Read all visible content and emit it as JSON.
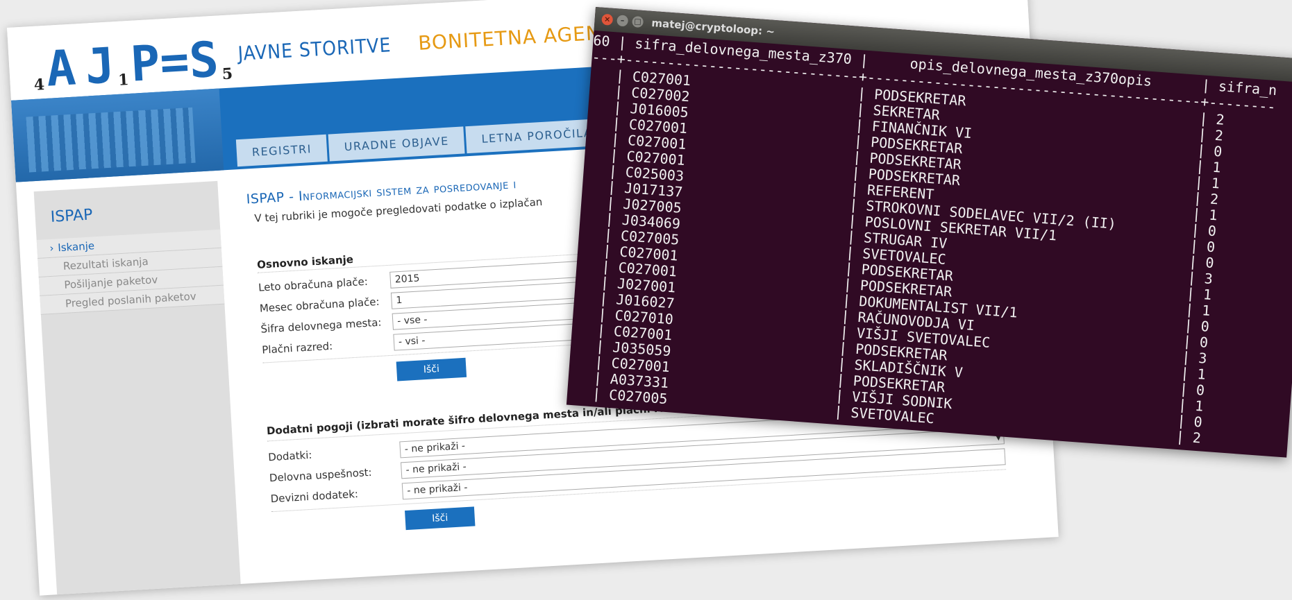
{
  "site": {
    "logo": {
      "letters": [
        "A",
        "J",
        "P",
        "=",
        "S"
      ],
      "subscripts": [
        "4",
        "1",
        "5"
      ]
    },
    "header_links": [
      "JAVNE STORITVE",
      "BONITETNA AGENCIJ"
    ],
    "nav_tabs": [
      "REGISTRI",
      "URADNE OBJAVE",
      "LETNA POROČILA"
    ],
    "sidebar": {
      "title": "ISPAP",
      "items": [
        {
          "label": "Iskanje",
          "active": true
        },
        {
          "label": "Rezultati iskanja",
          "active": false
        },
        {
          "label": "Pošiljanje paketov",
          "active": false
        },
        {
          "label": "Pregled poslanih paketov",
          "active": false
        }
      ]
    },
    "main": {
      "title": "ISPAP - Informacijski sistem za posredovanje i",
      "description": "V tej rubriki je mogoče pregledovati podatke o izplačan",
      "basic": {
        "title": "Osnovno iskanje",
        "fields": [
          {
            "label": "Leto obračuna plače:",
            "value": "2015"
          },
          {
            "label": "Mesec obračuna plače:",
            "value": "1"
          },
          {
            "label": "Šifra delovnega mesta:",
            "value": "- vse -"
          },
          {
            "label": "Plačni razred:",
            "value": "- vsi -"
          }
        ],
        "search_label": "Išči"
      },
      "extra": {
        "title": "Dodatni pogoji   (izbrati morate šifro delovnega mesta in/ali plačni razred)",
        "fields": [
          {
            "label": "Dodatki:",
            "value": "- ne prikaži -"
          },
          {
            "label": "Delovna uspešnost:",
            "value": "- ne prikaži -"
          },
          {
            "label": "Devizni dodatek:",
            "value": "- ne prikaži -"
          }
        ],
        "search_label": "Išči"
      }
    }
  },
  "terminal": {
    "title": "matej@cryptoloop: ~",
    "header": "60 | sifra_delovnega_mesta_z370 |     opis_delovnega_mesta_z370opis      | sifra_n",
    "separator": "---+----------------------------+----------------------------------------+--------",
    "rows": [
      {
        "code": "C027001",
        "desc": "PODSEKRETAR",
        "num": "2"
      },
      {
        "code": "C027002",
        "desc": "SEKRETAR",
        "num": "2"
      },
      {
        "code": "J016005",
        "desc": "FINANČNIK VI",
        "num": "0"
      },
      {
        "code": "C027001",
        "desc": "PODSEKRETAR",
        "num": "1"
      },
      {
        "code": "C027001",
        "desc": "PODSEKRETAR",
        "num": "1"
      },
      {
        "code": "C027001",
        "desc": "PODSEKRETAR",
        "num": "2"
      },
      {
        "code": "C025003",
        "desc": "REFERENT",
        "num": "1"
      },
      {
        "code": "J017137",
        "desc": "STROKOVNI SODELAVEC VII/2 (II)",
        "num": "0"
      },
      {
        "code": "J027005",
        "desc": "POSLOVNI SEKRETAR VII/1",
        "num": "0"
      },
      {
        "code": "J034069",
        "desc": "STRUGAR IV",
        "num": "0"
      },
      {
        "code": "C027005",
        "desc": "SVETOVALEC",
        "num": "3"
      },
      {
        "code": "C027001",
        "desc": "PODSEKRETAR",
        "num": "1"
      },
      {
        "code": "C027001",
        "desc": "PODSEKRETAR",
        "num": "1"
      },
      {
        "code": "J027001",
        "desc": "DOKUMENTALIST VII/1",
        "num": "0"
      },
      {
        "code": "J016027",
        "desc": "RAČUNOVODJA VI",
        "num": "0"
      },
      {
        "code": "C027010",
        "desc": "VIŠJI SVETOVALEC",
        "num": "3"
      },
      {
        "code": "C027001",
        "desc": "PODSEKRETAR",
        "num": "1"
      },
      {
        "code": "J035059",
        "desc": "SKLADIŠČNIK V",
        "num": "0"
      },
      {
        "code": "C027001",
        "desc": "PODSEKRETAR",
        "num": "1"
      },
      {
        "code": "A037331",
        "desc": "VIŠJI SODNIK",
        "num": "0"
      },
      {
        "code": "C027005",
        "desc": "SVETOVALEC",
        "num": "2"
      }
    ],
    "prompt": ":"
  }
}
